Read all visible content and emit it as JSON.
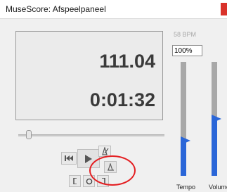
{
  "window": {
    "title": "MuseScore: Afspeelpaneel"
  },
  "display": {
    "measure_beat": "111.04",
    "time": "0:01:32"
  },
  "tempo": {
    "bpm_label": "58 BPM",
    "percent_value": "100%",
    "slider_level": 0.33
  },
  "volume": {
    "slider_level": 0.52
  },
  "sliders": {
    "tempo_label": "Tempo",
    "volume_label": "Volume"
  },
  "position_slider": {
    "level": 0.05
  },
  "controls": {
    "rewind_icon": "rewind-icon",
    "play_icon": "play-icon",
    "metronome_icon": "metronome-icon",
    "countin_icon": "count-in-icon",
    "loop_in_icon": "loop-in-icon",
    "loop_icon": "loop-icon",
    "loop_out_icon": "loop-out-icon"
  },
  "colors": {
    "accent": "#2a66d8",
    "annotation": "#e41f22",
    "close": "#d9322a"
  }
}
